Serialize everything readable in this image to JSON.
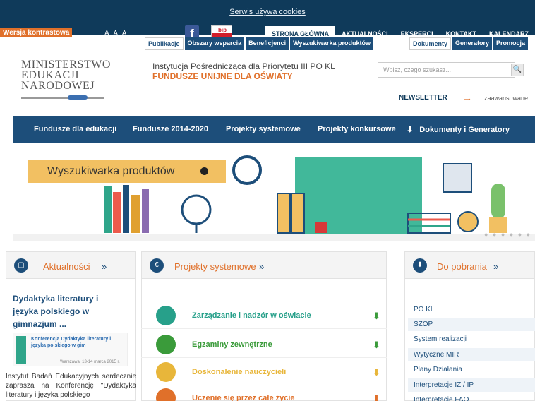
{
  "topbar": {
    "cookies": "Serwis używa cookies",
    "contrast": "Wersja kontrastowa",
    "font_sizes": "A A A",
    "fb": "f",
    "bip": "bip",
    "nav": [
      "STRONA GŁÓWNA",
      "AKTUALNOŚCI",
      "EKSPERCI",
      "KONTAKT",
      "KALENDARZ"
    ]
  },
  "header": {
    "logo_lines": [
      "MINISTERSTWO",
      "EDUKACJI",
      "NARODOWEJ"
    ],
    "institution": "Instytucja Pośrednicząca dla Priorytetu III PO KL",
    "funds": "FUNDUSZE UNIJNE DLA OŚWIATY",
    "search_placeholder": "Wpisz, czego szukasz...",
    "newsletter": "NEWSLETTER",
    "advanced": "zaawansowane"
  },
  "mainnav": [
    "Fundusze dla edukacji",
    "Fundusze 2014-2020",
    "Projekty systemowe",
    "Projekty konkursowe",
    "Dokumenty i Generatory"
  ],
  "banner": {
    "search_label": "Wyszukiwarka produktów"
  },
  "news": {
    "title": "Aktualności",
    "headline": "Dydaktyka literatury i języka polskiego w gimnazjum ...",
    "image_caption": "Konferencja Dydaktyka literatury i języka polskiego w gim",
    "image_date": "Warszawa, 13-14 marca 2015 r.",
    "body": "Instytut Badań Edukacyjnych serdecznie zaprasza na Konferencję \"Dydaktyka literatury i języka polskiego"
  },
  "projects": {
    "title": "Projekty systemowe",
    "tabs": [
      "Publikacje",
      "Obszary wsparcia",
      "Beneficjenci",
      "Wyszukiwarka produktów"
    ],
    "items": [
      {
        "label": "Zarządzanie i nadzór w oświacie",
        "color": "#27a08a"
      },
      {
        "label": "Egzaminy zewnętrzne",
        "color": "#3a9b3a"
      },
      {
        "label": "Doskonalenie nauczycieli",
        "color": "#e8b63a"
      },
      {
        "label": "Uczenie się przez całe życie",
        "color": "#e0702a"
      }
    ]
  },
  "downloads": {
    "title": "Do pobrania",
    "tabs": [
      "Dokumenty",
      "Generatory",
      "Promocja"
    ],
    "items": [
      "PO KL",
      "SZOP",
      "System realizacji",
      "Wytyczne MIR",
      "Plany Działania",
      "Interpretacje IZ / IP",
      "Interpretacje FAQ"
    ]
  },
  "colors": {
    "navy": "#0f3a5a",
    "blue": "#1d4e7a",
    "orange": "#e0702a"
  }
}
